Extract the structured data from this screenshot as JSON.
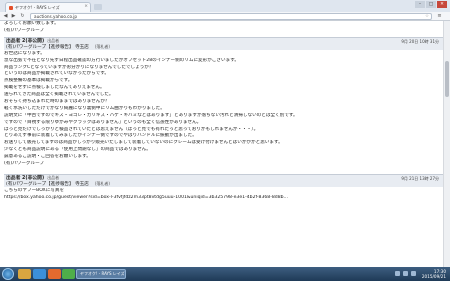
{
  "browser": {
    "tab_title": "ヤフオク! - RAYS レイズ",
    "tab_close": "×",
    "window_buttons": [
      "–",
      "□",
      "✕"
    ],
    "url": "auctions.yahoo.co.jp"
  },
  "messages": [
    {
      "lines_before": [
        "よろしくお願い致します。",
        "(有)パワーグループ"
      ]
    }
  ],
  "msg1": {
    "from": "出品者 2(非公開)",
    "from_tag": "出品者",
    "to": "(有)パワーグループ【進捗報告】 寺玉店",
    "to_tag": "(落札者)",
    "date": "9月 20日 10時 31分",
    "body": [
      "お世話になります。",
      "急な出張で不在となり先ず日程出品確認の方行いましたがオフセット28のインナー側のリムに変形がございます。",
      "商品ランクCとなっていますがお分かりになりませんでしたでしょうか？",
      "というのは商品が掲載されていなかったからです。",
      "点検整備の基本は掲載からです。",
      "掲載をせずに点検しましたなんてありえません。",
      "送られてきた商品は全く掲載されていませんでした。",
      "おそらく持ち込まれた時のままではありませんか？",
      "軽く水洗いしただけでかなり綺麗になり裏側中にリム曲がりもわかりました。",
      "説明文に「中古ですのでキズ・ヨゴレ・ガリキズ・ハゲ・キバミなどはあります」とありますが落ちない汚れと清掃しないのとは全く別です。",
      "ですので「目視する限りゆがみやクラックはありません」というのも全く信憑性がありません。",
      "ぱっと見だけでしっかりと検品されていたとは思えません（ぱっと見でも有れたっと思っておりかもしれませんが・・・）。",
      "とりあえず事前に装着してみましたがインナー側ですのでやはりハンドルに振動が出ました。",
      "お送りして販売してますのは商品かしっかり販売いたしまして装着していないのにクレームは受け付けませんとはいかがかと思います。",
      "少なくとも商品説明にある「使用上問題なし」の商品ではありません。",
      "誠意あるご説明・ご回答をお願いします。"
    ],
    "signature": "(有)パワーグループ"
  },
  "msg2": {
    "from": "出品者 2(非公開)",
    "from_tag": "出品者",
    "to": "(有)パワーグループ【進捗報告】 寺玉店",
    "to_tag": "(落札者)",
    "date": "9月 21日 13時 27分",
    "body": [
      "こちらのヤフーBOXに写真を",
      "https://box.yahoo.co.jp/guest/viewer?sid=box-l-3fvfjfdz2m33pt8vtdg5uuu-1001&uniqid=3b325798-e3e1-4b2f-8368-8d8b..."
    ]
  },
  "taskbar": {
    "task_label": "ヤフオク! - RAYS レイズ",
    "time": "17:30",
    "date": "2015/09/21"
  }
}
